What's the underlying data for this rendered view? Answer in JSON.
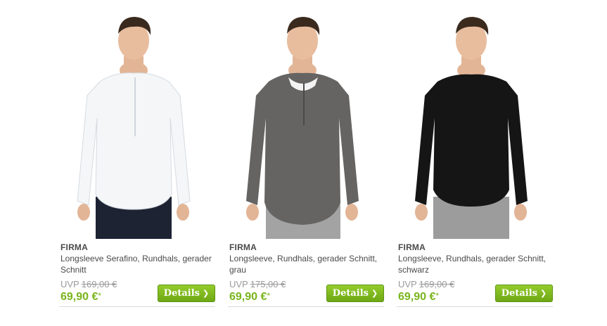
{
  "products": [
    {
      "brand": "FIRMA",
      "title": "Longsleeve Serafino, Rundhals, gerader Schnitt",
      "uvp_label": "UVP",
      "uvp_price": "169,00 €",
      "price": "69,90 €",
      "price_mark": "*",
      "details_label": "Details",
      "details_icon": "chevron-right-icon",
      "shirt_color": "#f4f6f8",
      "pants_color": "#1d2333"
    },
    {
      "brand": "FIRMA",
      "title": "Longsleeve, Rundhals, gerader Schnitt, grau",
      "uvp_label": "UVP",
      "uvp_price": "175,00 €",
      "price": "69,90 €",
      "price_mark": "*",
      "details_label": "Details",
      "details_icon": "chevron-right-icon",
      "shirt_color": "#656463",
      "pants_color": "#a3a3a3"
    },
    {
      "brand": "FIRMA",
      "title": "Longsleeve, Rundhals, gerader Schnitt, schwarz",
      "uvp_label": "UVP",
      "uvp_price": "169,00 €",
      "price": "69,90 €",
      "price_mark": "*",
      "details_label": "Details",
      "details_icon": "chevron-right-icon",
      "shirt_color": "#151515",
      "pants_color": "#9c9c9c"
    }
  ],
  "colors": {
    "price_green": "#7ab51d",
    "button_green": "#84bd22",
    "text_gray": "#4a4a4a",
    "uvp_gray": "#9a9a9a"
  }
}
